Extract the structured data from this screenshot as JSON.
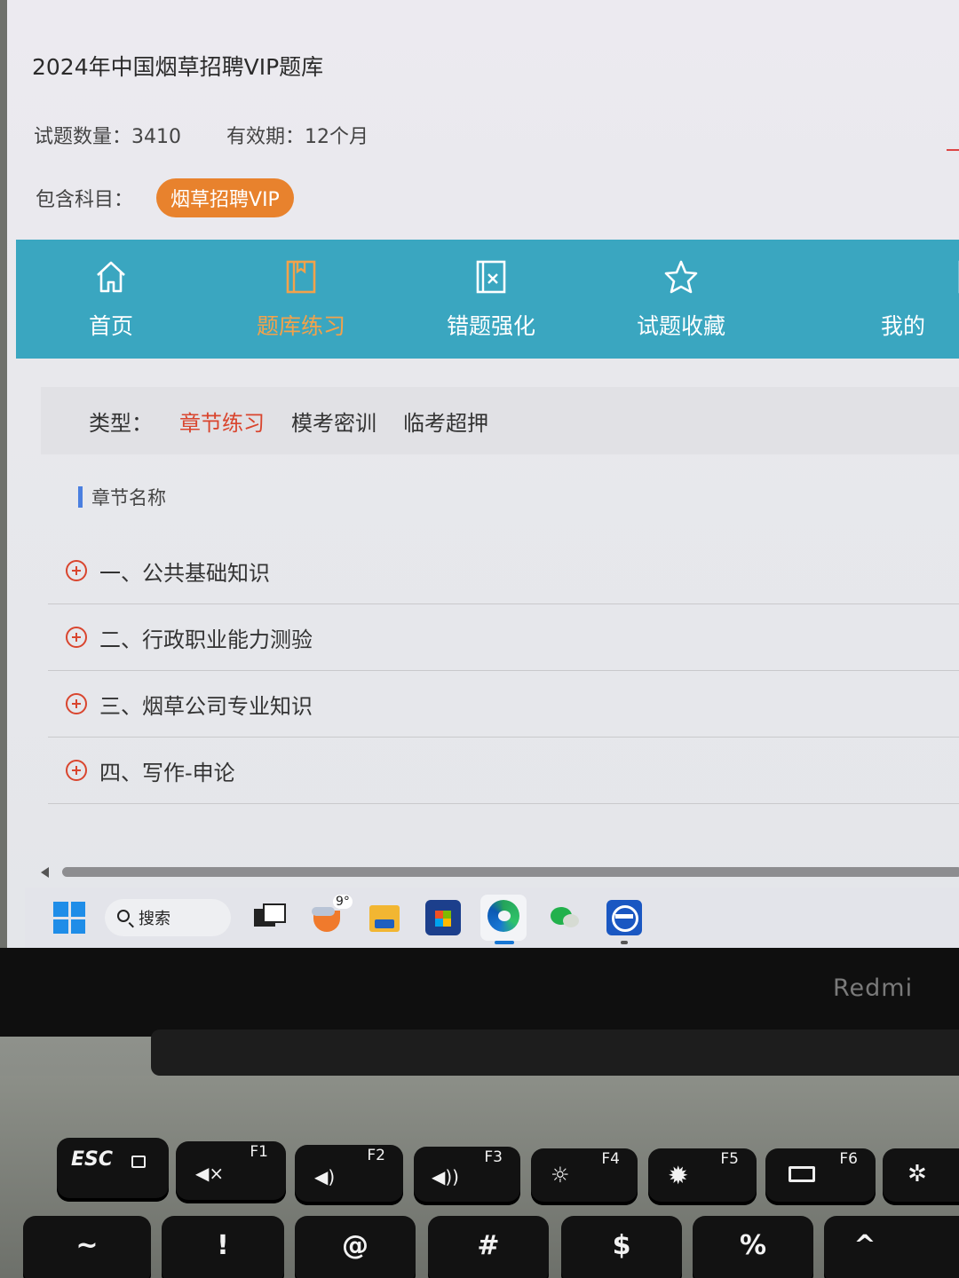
{
  "course": {
    "title": "2024年中国烟草招聘VIP题库",
    "question_count": "试题数量：3410",
    "validity": "有效期：12个月",
    "subjects_label": "包含科目：",
    "subject_tag": "烟草招聘VIP"
  },
  "nav": {
    "items": [
      {
        "label": "首页",
        "icon": "home-icon"
      },
      {
        "label": "题库练习",
        "icon": "book-icon",
        "active": true
      },
      {
        "label": "错题强化",
        "icon": "wrong-icon"
      },
      {
        "label": "试题收藏",
        "icon": "star-icon"
      },
      {
        "label": "我的",
        "icon": "edit-icon"
      }
    ],
    "active_color": "#f3a24a",
    "bar_color": "#3aa6c0"
  },
  "type_filter": {
    "label": "类型：",
    "options": [
      "章节练习",
      "模考密训",
      "临考超押"
    ],
    "active_index": 0,
    "active_color": "#d9452e"
  },
  "chapters": {
    "heading": "章节名称",
    "items": [
      "一、公共基础知识",
      "二、行政职业能力测验",
      "三、烟草公司专业知识",
      "四、写作-申论"
    ]
  },
  "taskbar": {
    "search_label": "搜索",
    "weather_temp": "9°",
    "apps": [
      "start-icon",
      "task-view-icon",
      "weather-icon",
      "file-explorer-icon",
      "store-icon",
      "edge-icon",
      "wechat-icon",
      "app-icon"
    ]
  },
  "laptop": {
    "brand": "Redmi",
    "keys": [
      {
        "main": "ESC",
        "fn": ""
      },
      {
        "main": "",
        "fn": "F1"
      },
      {
        "main": "",
        "fn": "F2"
      },
      {
        "main": "",
        "fn": "F3"
      },
      {
        "main": "",
        "fn": "F4"
      },
      {
        "main": "",
        "fn": "F5"
      },
      {
        "main": "",
        "fn": "F6"
      }
    ],
    "number_row": [
      "~",
      "!",
      "@",
      "#",
      "$",
      "%",
      "^"
    ]
  }
}
